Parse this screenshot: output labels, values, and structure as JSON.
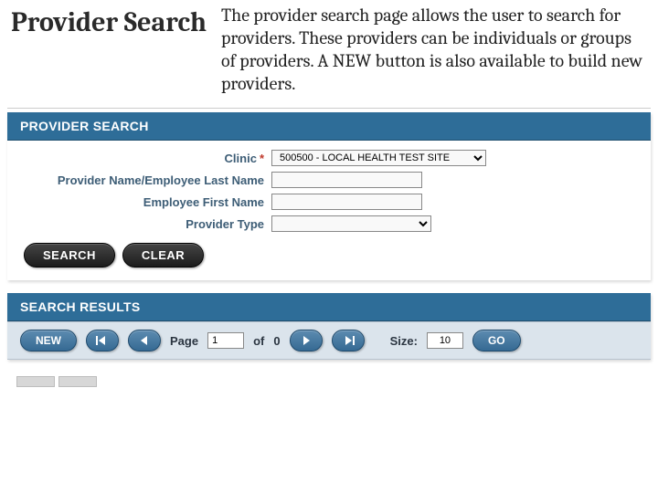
{
  "slide": {
    "title": "Provider Search",
    "description": "The provider search page allows the user to search for providers.  These providers can be individuals or groups of providers.  A NEW button is also available to build new providers."
  },
  "panels": {
    "search_header": "PROVIDER SEARCH",
    "results_header": "SEARCH RESULTS"
  },
  "form": {
    "clinic_label": "Clinic",
    "required_mark": "*",
    "clinic_value": "500500 - LOCAL HEALTH TEST SITE",
    "provider_name_label": "Provider Name/Employee Last Name",
    "provider_name_value": "",
    "first_name_label": "Employee First Name",
    "first_name_value": "",
    "provider_type_label": "Provider Type",
    "provider_type_value": ""
  },
  "buttons": {
    "search": "SEARCH",
    "clear": "CLEAR",
    "new": "NEW",
    "go": "GO"
  },
  "pager": {
    "page_label": "Page",
    "page_value": "1",
    "of_label": "of",
    "total_pages": "0",
    "size_label": "Size:",
    "size_value": "10"
  }
}
